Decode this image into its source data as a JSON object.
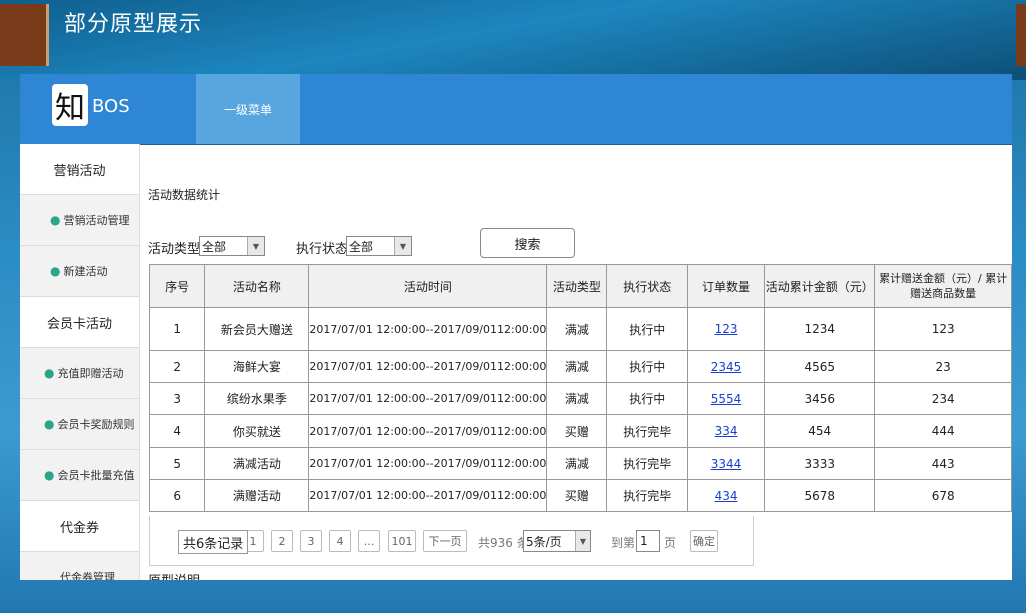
{
  "slide": {
    "title": "部分原型展示"
  },
  "header": {
    "logo_char": "知",
    "logo_text": "BOS",
    "menu_tab": "一级菜单"
  },
  "sidebar": {
    "items": [
      {
        "label": "营销活动",
        "type": "group"
      },
      {
        "label": "营销活动管理",
        "type": "sub"
      },
      {
        "label": "新建活动",
        "type": "sub"
      },
      {
        "label": "会员卡活动",
        "type": "group"
      },
      {
        "label": "充值即赠活动",
        "type": "sub"
      },
      {
        "label": "会员卡奖励规则",
        "type": "sub"
      },
      {
        "label": "会员卡批量充值",
        "type": "sub"
      },
      {
        "label": "代金券",
        "type": "group"
      },
      {
        "label": "代金券管理",
        "type": "sub"
      }
    ]
  },
  "main": {
    "section_title": "活动数据统计",
    "filters": {
      "type_label": "活动类型",
      "type_value": "全部",
      "status_label": "执行状态",
      "status_value": "全部",
      "search_button": "搜索"
    },
    "table": {
      "headers": [
        "序号",
        "活动名称",
        "活动时间",
        "活动类型",
        "执行状态",
        "订单数量",
        "活动累计金额（元）",
        "累计赠送金额（元）/ 累计赠送商品数量"
      ],
      "rows": [
        [
          "1",
          "新会员大赠送",
          "2017/07/01 12:00:00--2017/09/0112:00:00",
          "满减",
          "执行中",
          "123",
          "1234",
          "123"
        ],
        [
          "2",
          "海鲜大宴",
          "2017/07/01 12:00:00--2017/09/0112:00:00",
          "满减",
          "执行中",
          "2345",
          "4565",
          "23"
        ],
        [
          "3",
          "缤纷水果季",
          "2017/07/01 12:00:00--2017/09/0112:00:00",
          "满减",
          "执行中",
          "5554",
          "3456",
          "234"
        ],
        [
          "4",
          "你买就送",
          "2017/07/01 12:00:00--2017/09/0112:00:00",
          "买赠",
          "执行完毕",
          "334",
          "454",
          "444"
        ],
        [
          "5",
          "满减活动",
          "2017/07/01 12:00:00--2017/09/0112:00:00",
          "满减",
          "执行完毕",
          "3344",
          "3333",
          "443"
        ],
        [
          "6",
          "满赠活动",
          "2017/07/01 12:00:00--2017/09/0112:00:00",
          "买赠",
          "执行完毕",
          "434",
          "5678",
          "678"
        ]
      ]
    },
    "pager": {
      "total_records": "共6条记录",
      "pages": [
        "1",
        "2",
        "3",
        "4",
        "...",
        "101"
      ],
      "next": "下一页",
      "total_count": "共936 条",
      "per_page": "5条/页",
      "goto_prefix": "到第",
      "goto_value": "1",
      "goto_suffix": "页",
      "confirm": "确定"
    },
    "footer_partial": "原型说明"
  }
}
